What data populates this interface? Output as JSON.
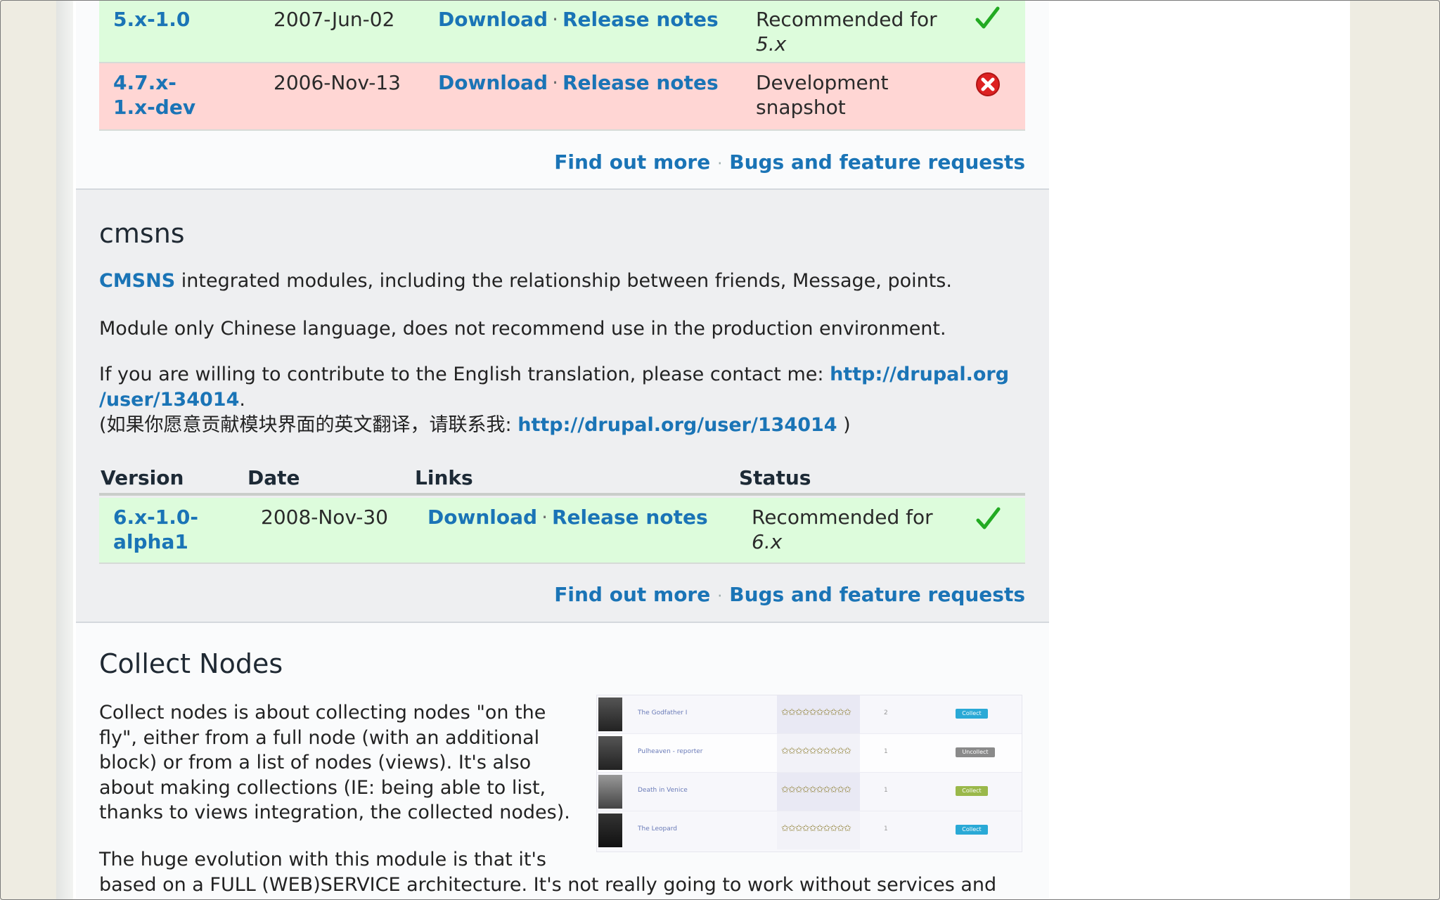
{
  "colors": {
    "link": "#1a74b6",
    "ok_row": "#ddfcdc",
    "bad_row": "#ffd6d4",
    "check": "#22aa22",
    "cross": "#dd2222"
  },
  "top_releases": [
    {
      "version": "5.x-1.0",
      "date": "2007-Jun-02",
      "download": "Download",
      "notes": "Release notes",
      "status_line1": "Recommended for",
      "status_line2": "5.x",
      "status_icon": "check-icon"
    },
    {
      "version_line1": "4.7.x-",
      "version_line2": "1.x-dev",
      "date": "2006-Nov-13",
      "download": "Download",
      "notes": "Release notes",
      "status_line1": "Development",
      "status_line2": "snapshot",
      "status_icon": "error-icon"
    }
  ],
  "footer_links": {
    "find_out_more": "Find out more",
    "bugs": "Bugs and feature requests"
  },
  "cmsns": {
    "title": "cmsns",
    "p1_link": "CMSNS",
    "p1_text": " integrated modules, including the relationship between friends, Message, points.",
    "p2": "Module only Chinese language, does not recommend use in the production environment.",
    "p3_text": "If you are willing to contribute to the English translation, please contact me: ",
    "p3_link_a": "http://drupal.org",
    "p3_link_b": "/user/134014",
    "p3_period": ".",
    "p4_text": "(如果你愿意贡献模块界面的英文翻译，请联系我: ",
    "p4_link": "http://drupal.org/user/134014",
    "p4_close": " )",
    "table_headers": {
      "version": "Version",
      "date": "Date",
      "links": "Links",
      "status": "Status"
    },
    "release": {
      "version_line1": "6.x-1.0-",
      "version_line2": "alpha1",
      "date": "2008-Nov-30",
      "download": "Download",
      "notes": "Release notes",
      "status_line1": "Recommended for",
      "status_line2": "6.x",
      "status_icon": "check-icon"
    }
  },
  "collect_nodes": {
    "title": "Collect Nodes",
    "lines": [
      "Collect nodes is about collecting nodes \"on the",
      "fly\", either from a full node (with an additional",
      "block) or from a list of nodes (views). It's also",
      "about making collections (IE: being able to list,",
      "thanks to views integration, the collected nodes)."
    ],
    "p2_line1": "The huge evolution with this module is that it's",
    "p2_line2": "based on a FULL (WEB)SERVICE architecture. It's not really going to work without services and",
    "screenshot_rows": [
      {
        "title": "The Godfather I",
        "stars": "✩✩✩✩✩✩✩✩✩✩",
        "count": "2",
        "button": "Collect",
        "button_color": "#2aa9d6"
      },
      {
        "title": "Pulheaven - reporter",
        "stars": "✩✩✩✩✩✩✩✩✩✩",
        "count": "1",
        "button": "Uncollect",
        "button_color": "#8a8a8a"
      },
      {
        "title": "Death in Venice",
        "stars": "✩✩✩✩✩✩✩✩✩✩",
        "count": "1",
        "button": "Collect",
        "button_color": "#9ab84a"
      },
      {
        "title": "The Leopard",
        "stars": "✩✩✩✩✩✩✩✩✩✩",
        "count": "1",
        "button": "Collect",
        "button_color": "#2aa9d6"
      }
    ]
  }
}
